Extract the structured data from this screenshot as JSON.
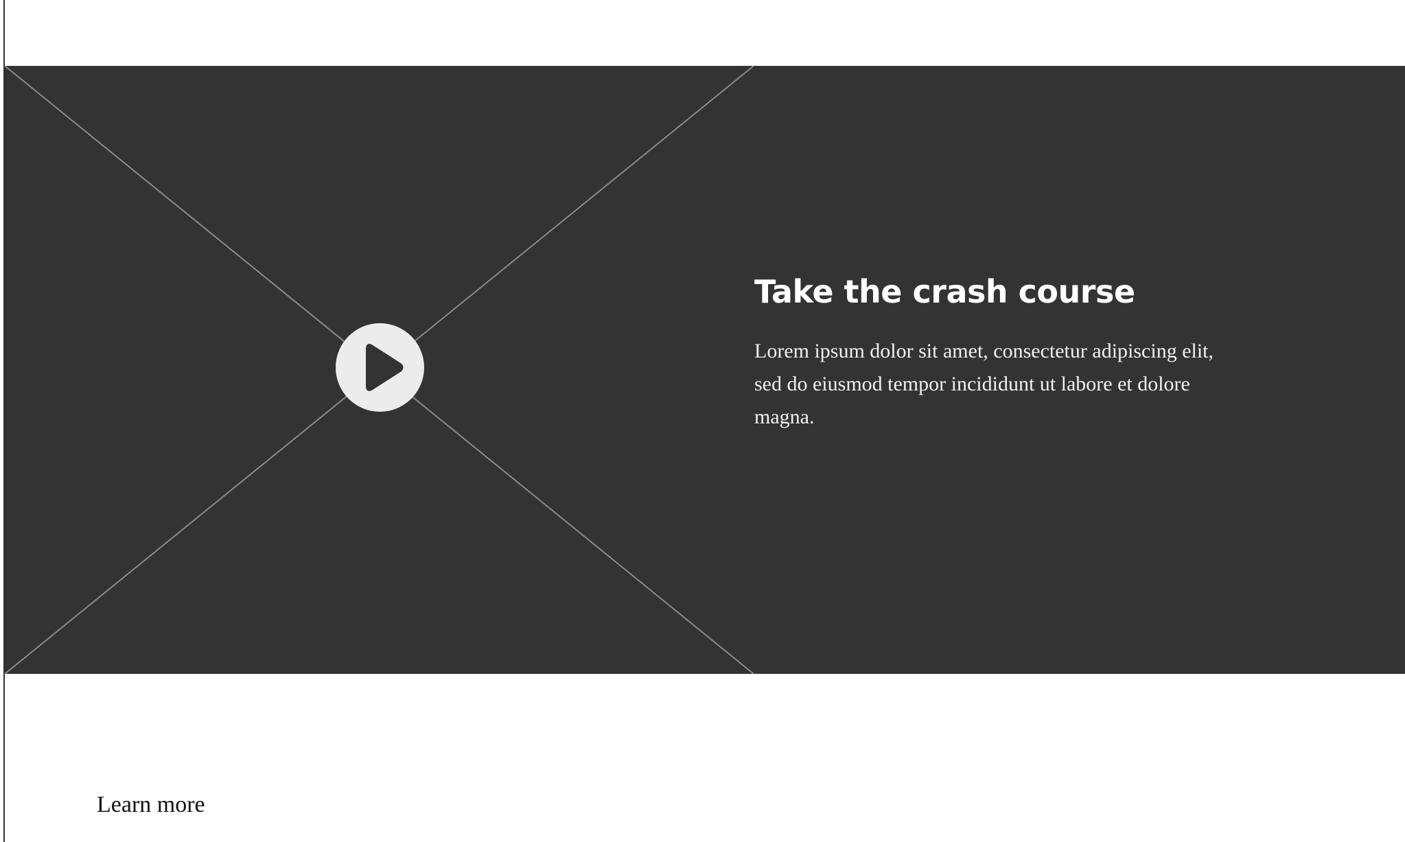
{
  "hero": {
    "title": "Take the crash course",
    "body": "Lorem ipsum dolor sit amet, consectetur adipiscing elit, sed do eiusmod tempor incididunt ut labore et dolore magna."
  },
  "video": {
    "play_icon": "play-icon"
  },
  "footer": {
    "learn_more_label": "Learn more"
  },
  "colors": {
    "hero_background": "#333333",
    "placeholder_lines": "#8a8a8a",
    "play_button_fill": "#ececec",
    "play_icon": "#333333",
    "title_text": "#ffffff",
    "page_background": "#ffffff"
  }
}
